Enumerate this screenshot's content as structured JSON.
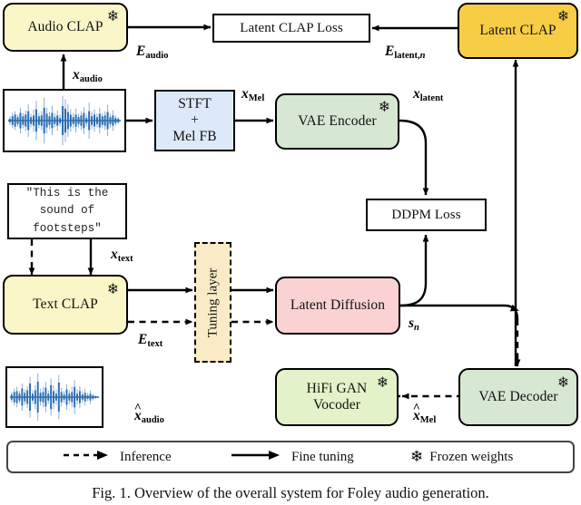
{
  "figure": {
    "caption": "Fig. 1.   Overview of the overall system for Foley audio generation."
  },
  "nodes": {
    "audio_clap": {
      "label": "Audio CLAP",
      "color": "#FBF6C8",
      "frozen": true
    },
    "latent_clap": {
      "label": "Latent CLAP",
      "color": "#F8CD46",
      "frozen": true
    },
    "latent_clap_loss": {
      "label": "Latent CLAP Loss",
      "color": "#FFFFFF",
      "frozen": false
    },
    "stft_mel": {
      "label_line1": "STFT",
      "label_line2": "+",
      "label_line3": "Mel FB",
      "color": "#DCE9F8",
      "frozen": false
    },
    "vae_encoder": {
      "label": "VAE Encoder",
      "color": "#D6E7D2",
      "frozen": true
    },
    "ddpm_loss": {
      "label": "DDPM Loss",
      "color": "#FFFFFF",
      "frozen": false
    },
    "text_clap": {
      "label": "Text CLAP",
      "color": "#FBF6C8",
      "frozen": true
    },
    "tuning_layer": {
      "label": "Tuning layer",
      "color": "#FAEBC6",
      "frozen": false
    },
    "latent_diffusion": {
      "label": "Latent Diffusion",
      "color": "#FAD2D2",
      "frozen": false
    },
    "hifi_gan": {
      "label_line1": "HiFi GAN",
      "label_line2": "Vocoder",
      "color": "#E3F2C9",
      "frozen": true
    },
    "vae_decoder": {
      "label": "VAE Decoder",
      "color": "#D6E7D2",
      "frozen": true
    },
    "text_prompt": {
      "line1": "\"This is the",
      "line2": "sound of",
      "line3": "footsteps\"",
      "color": "#FFFFFF"
    },
    "input_waveform": {
      "name": "input audio waveform",
      "color": "#2B6CB0"
    },
    "output_waveform": {
      "name": "output audio waveform",
      "color": "#2B6CB0"
    }
  },
  "edge_labels": {
    "e_audio": {
      "sym": "E",
      "sub": "audio"
    },
    "x_audio": {
      "sym": "x",
      "sub": "audio"
    },
    "x_mel": {
      "sym": "x",
      "sub": "Mel"
    },
    "x_latent": {
      "sym": "x",
      "sub": "latent"
    },
    "e_latent_n": {
      "sym": "E",
      "sub": "latent,",
      "sub_it": "n"
    },
    "x_text": {
      "sym": "x",
      "sub": "text"
    },
    "e_text": {
      "sym": "E",
      "sub": "text"
    },
    "s_n": {
      "sym": "s",
      "sub_it": "n"
    },
    "x_hat_audio": {
      "sym": "x",
      "sub": "audio",
      "hat": true
    },
    "x_hat_mel": {
      "sym": "x",
      "sub": "Mel",
      "hat": true
    }
  },
  "legend": {
    "inference": {
      "label": "Inference",
      "style": "dashed-arrow"
    },
    "fine_tuning": {
      "label": "Fine tuning",
      "style": "solid-arrow"
    },
    "frozen": {
      "label": "Frozen weights",
      "style": "snowflake-icon",
      "glyph": "❄"
    }
  },
  "icons": {
    "snowflake": "❄"
  }
}
